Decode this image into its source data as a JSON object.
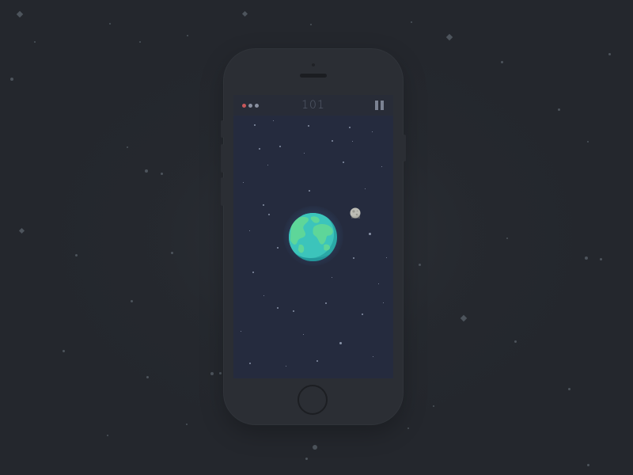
{
  "status_bar": {
    "score": "101",
    "indicator_dots": [
      "#c8575a",
      "#8a90a0",
      "#8a90a0"
    ],
    "pause_icon": "pause-icon"
  },
  "colors": {
    "background": "#24272d",
    "phone_body": "#2b2e34",
    "screen": "#252b3e",
    "earth_ocean": "#3fc0b8",
    "earth_land": "#5ed699",
    "moon": "#bdbdb5"
  },
  "scene": {
    "planet": "earth-icon",
    "satellite": "moon-icon"
  }
}
